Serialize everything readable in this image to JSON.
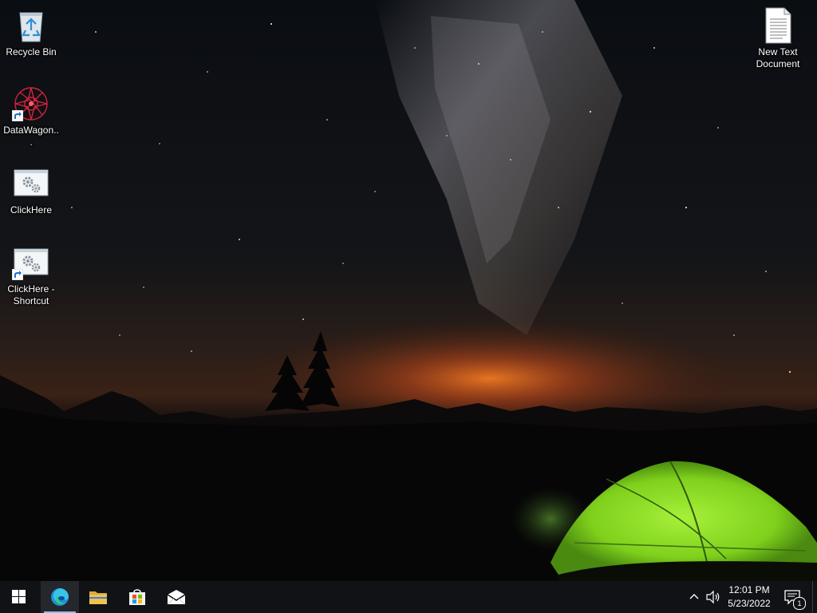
{
  "desktop": {
    "icons": [
      {
        "label": "Recycle Bin",
        "icon": "recycle-bin-icon",
        "shortcut": false
      },
      {
        "label": "DataWagon...",
        "icon": "datawagon-icon",
        "shortcut": true
      },
      {
        "label": "ClickHere",
        "icon": "gear-window-icon",
        "shortcut": false
      },
      {
        "label": "ClickHere - Shortcut",
        "icon": "gear-window-icon",
        "shortcut": true
      },
      {
        "label": "New Text Document",
        "icon": "text-document-icon",
        "shortcut": false
      }
    ]
  },
  "taskbar": {
    "pinned": [
      {
        "name": "start",
        "icon": "windows-logo-icon"
      },
      {
        "name": "edge",
        "icon": "edge-icon",
        "active": true
      },
      {
        "name": "file-explorer",
        "icon": "folder-icon"
      },
      {
        "name": "store",
        "icon": "store-icon"
      },
      {
        "name": "mail",
        "icon": "mail-icon"
      }
    ],
    "tray": {
      "time": "12:01 PM",
      "date": "5/23/2022",
      "notification_count": "1"
    }
  },
  "colors": {
    "taskbar_bg": "#101216",
    "tent_green": "#8fe21f",
    "horizon_orange": "#e0651a",
    "edge_blue": "#1f8fd8",
    "folder_yellow": "#f2c14e"
  }
}
